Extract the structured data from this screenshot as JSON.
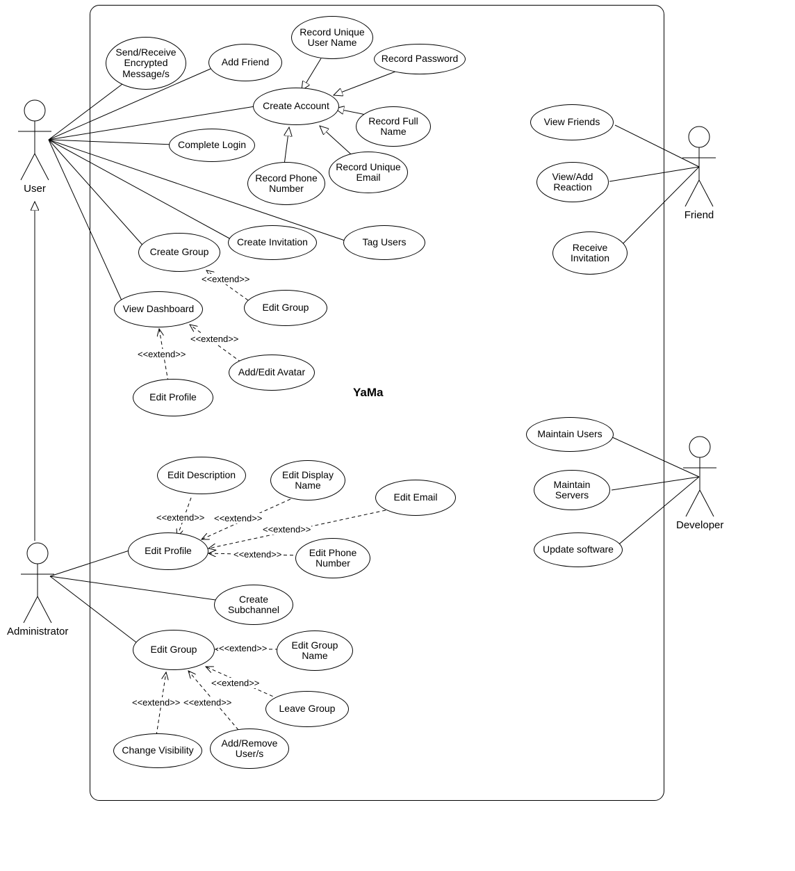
{
  "system": {
    "title": "YaMa"
  },
  "actors": {
    "user": "User",
    "administrator": "Administrator",
    "friend": "Friend",
    "developer": "Developer"
  },
  "usecases": {
    "send_receive_encrypted": "Send/Receive Encrypted Message/s",
    "add_friend": "Add Friend",
    "record_unique_user_name": "Record Unique User Name",
    "record_password": "Record Password",
    "create_account": "Create Account",
    "record_full_name": "Record Full Name",
    "complete_login": "Complete Login",
    "record_phone_number": "Record Phone Number",
    "record_unique_email": "Record Unique Email",
    "create_group": "Create Group",
    "create_invitation": "Create Invitation",
    "tag_users": "Tag Users",
    "view_dashboard": "View Dashboard",
    "edit_group_user": "Edit Group",
    "add_edit_avatar": "Add/Edit Avatar",
    "edit_profile_user": "Edit Profile",
    "edit_description": "Edit Description",
    "edit_display_name": "Edit Display Name",
    "edit_email": "Edit Email",
    "edit_profile_admin": "Edit Profile",
    "edit_phone_number": "Edit Phone Number",
    "create_subchannel": "Create Subchannel",
    "edit_group_admin": "Edit Group",
    "edit_group_name": "Edit Group Name",
    "leave_group": "Leave Group",
    "change_visibility": "Change Visibility",
    "add_remove_users": "Add/Remove User/s",
    "view_friends": "View Friends",
    "view_add_reaction": "View/Add Reaction",
    "receive_invitation": "Receive Invitation",
    "maintain_users": "Maintain Users",
    "maintain_servers": "Maintain Servers",
    "update_software": "Update software"
  },
  "stereotypes": {
    "extend": "<<extend>>"
  }
}
